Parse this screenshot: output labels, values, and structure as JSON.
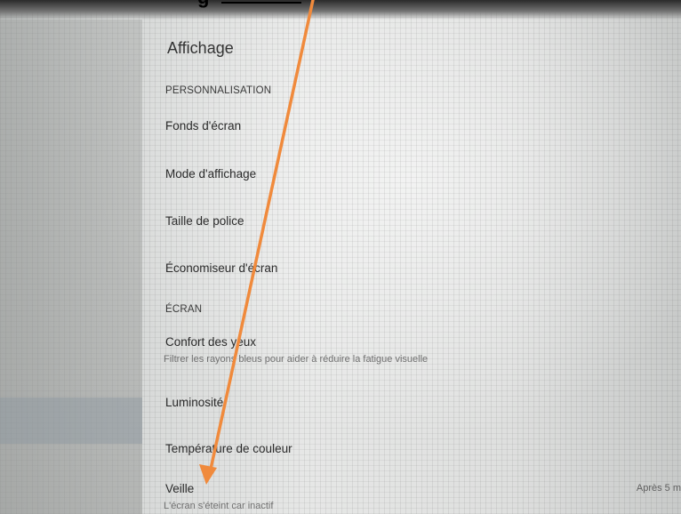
{
  "caption": {
    "text": "g"
  },
  "settings": {
    "title": "Affichage",
    "sections": {
      "personnalisation": "PERSONNALISATION",
      "ecran": "ÉCRAN"
    },
    "items": {
      "fonds": "Fonds d'écran",
      "mode": "Mode d'affichage",
      "taille": "Taille de police",
      "economiseur": "Économiseur d'écran",
      "confort": "Confort des yeux",
      "confort_sub": "Filtrer les rayons bleus pour aider à réduire la fatigue visuelle",
      "luminosite": "Luminosité",
      "temperature": "Température de couleur",
      "veille": "Veille",
      "veille_sub": "L'écran s'éteint car inactif",
      "veille_value": "Après 5 m"
    }
  },
  "colors": {
    "arrow": "#f08a3c"
  }
}
